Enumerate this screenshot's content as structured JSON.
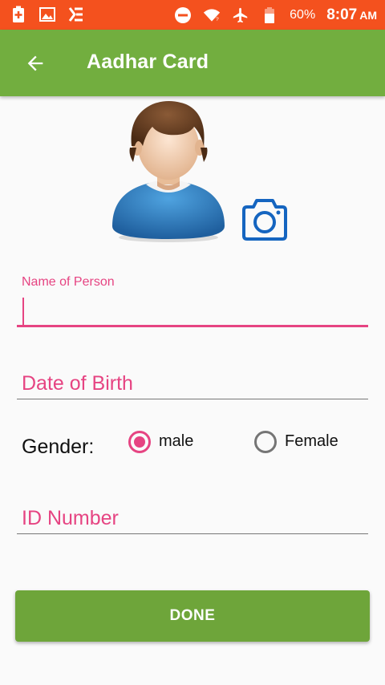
{
  "status_bar": {
    "battery_percent": "60%",
    "time": "8:07",
    "ampm": "AM",
    "left_icons": [
      "battery-saver-icon",
      "image-icon",
      "checklist-icon"
    ],
    "right_icons": [
      "do-not-disturb-icon",
      "wifi-icon",
      "airplane-mode-icon",
      "battery-icon"
    ]
  },
  "toolbar": {
    "title": "Aadhar Card",
    "back_icon": "arrow-back-icon",
    "color": "#72ae3f"
  },
  "form": {
    "photo_icon": "camera-icon",
    "name_field": {
      "label": "Name of Person",
      "value": ""
    },
    "dob_field": {
      "placeholder": "Date of Birth",
      "value": ""
    },
    "gender": {
      "label": "Gender:",
      "options": [
        {
          "label": "male",
          "checked": true
        },
        {
          "label": "Female",
          "checked": false
        }
      ]
    },
    "id_field": {
      "placeholder": "ID Number",
      "value": ""
    },
    "done_label": "DONE"
  },
  "colors": {
    "status_bar": "#f4511e",
    "accent": "#e64482",
    "primary": "#72ae3f",
    "camera": "#1565c0"
  }
}
